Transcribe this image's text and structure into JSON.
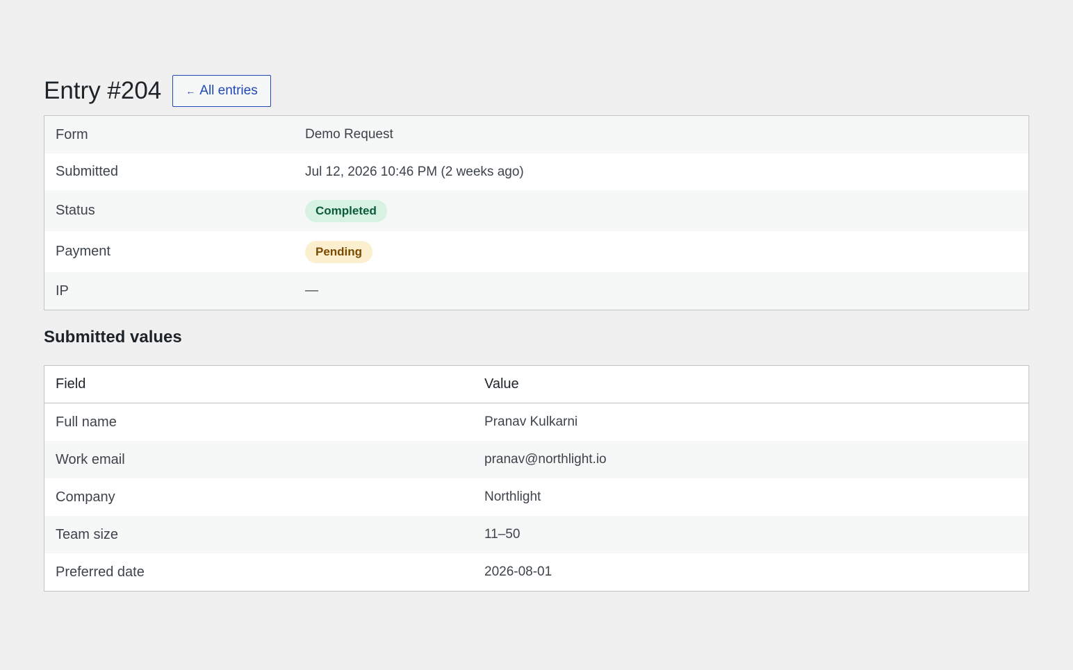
{
  "header": {
    "title": "Entry #204",
    "back_arrow": "←",
    "back_label": "All entries"
  },
  "meta": {
    "form_label": "Form",
    "form_value": "Demo Request",
    "submitted_label": "Submitted",
    "submitted_value": "Jul 12, 2026 10:46 PM (2 weeks ago)",
    "status_label": "Status",
    "status_value": "Completed",
    "payment_label": "Payment",
    "payment_value": "Pending",
    "ip_label": "IP",
    "ip_value": "—"
  },
  "values_section": {
    "heading": "Submitted values",
    "col_field": "Field",
    "col_value": "Value",
    "rows": [
      {
        "field": "Full name",
        "value": "Pranav Kulkarni"
      },
      {
        "field": "Work email",
        "value": "pranav@northlight.io"
      },
      {
        "field": "Company",
        "value": "Northlight"
      },
      {
        "field": "Team size",
        "value": "11–50"
      },
      {
        "field": "Preferred date",
        "value": "2026-08-01"
      }
    ]
  },
  "colors": {
    "accent": "#2248b8",
    "status_completed_bg": "#d7f2e3",
    "status_pending_bg": "#fcefcf"
  }
}
